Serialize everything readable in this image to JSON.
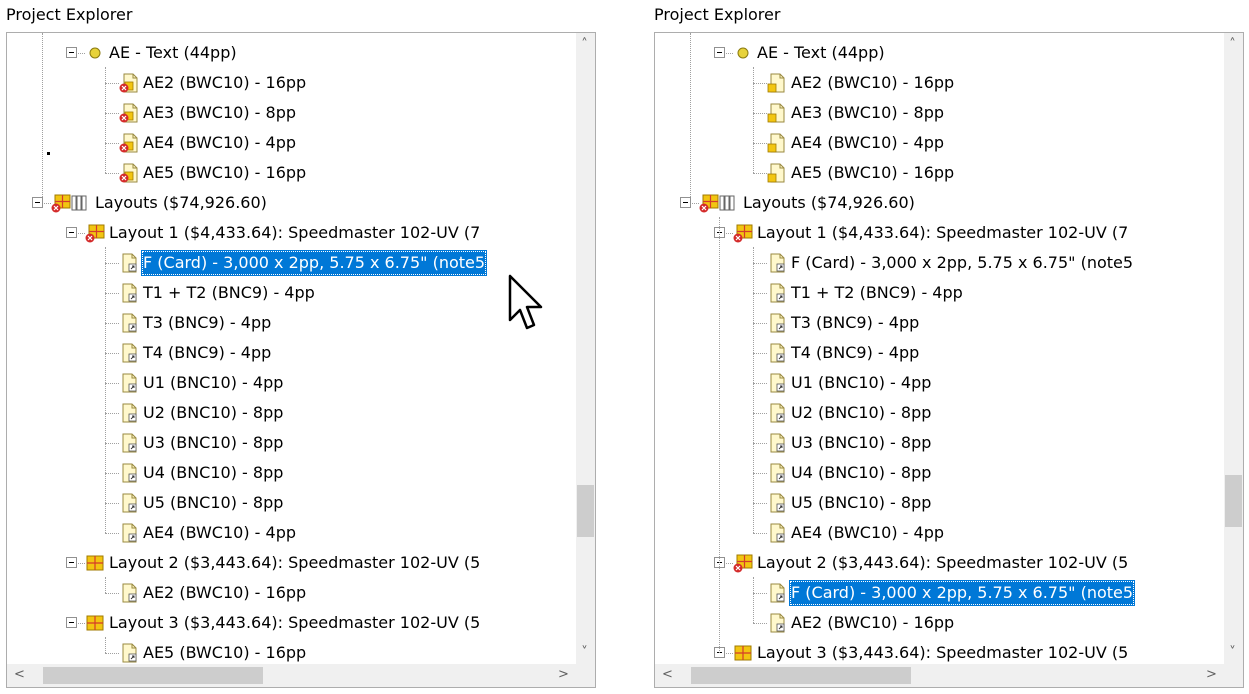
{
  "left": {
    "title": "Project Explorer",
    "items": [
      {
        "label": "AE - Text (44pp)",
        "icon": "status-dot-icon"
      },
      {
        "label": "AE2 (BWC10) - 16pp",
        "icon": "page-error-icon"
      },
      {
        "label": "AE3 (BWC10) - 8pp",
        "icon": "page-error-icon"
      },
      {
        "label": "AE4 (BWC10) - 4pp",
        "icon": "page-error-icon"
      },
      {
        "label": "AE5 (BWC10) - 16pp",
        "icon": "page-error-icon"
      },
      {
        "label": "Layouts ($74,926.60)",
        "icon": "layouts-error-icon"
      },
      {
        "label": "Layout 1 ($4,433.64): Speedmaster 102-UV (7",
        "icon": "layout-error-icon"
      },
      {
        "label": "F (Card) - 3,000 x 2pp, 5.75 x 6.75\" (note5",
        "icon": "page-link-icon",
        "selected": true
      },
      {
        "label": "T1 + T2 (BNC9) - 4pp",
        "icon": "page-link-icon"
      },
      {
        "label": "T3 (BNC9) - 4pp",
        "icon": "page-link-icon"
      },
      {
        "label": "T4 (BNC9) - 4pp",
        "icon": "page-link-icon"
      },
      {
        "label": "U1 (BNC10) - 4pp",
        "icon": "page-link-icon"
      },
      {
        "label": "U2 (BNC10) - 8pp",
        "icon": "page-link-icon"
      },
      {
        "label": "U3 (BNC10) - 8pp",
        "icon": "page-link-icon"
      },
      {
        "label": "U4 (BNC10) - 8pp",
        "icon": "page-link-icon"
      },
      {
        "label": "U5 (BNC10) - 8pp",
        "icon": "page-link-icon"
      },
      {
        "label": "AE4 (BWC10) - 4pp",
        "icon": "page-link-icon"
      },
      {
        "label": "Layout 2 ($3,443.64): Speedmaster 102-UV (5",
        "icon": "layout-icon"
      },
      {
        "label": "AE2 (BWC10) - 16pp",
        "icon": "page-link-icon"
      },
      {
        "label": "Layout 3 ($3,443.64): Speedmaster 102-UV (5",
        "icon": "layout-icon"
      },
      {
        "label": "AE5 (BWC10) - 16pp",
        "icon": "page-link-icon"
      }
    ]
  },
  "right": {
    "title": "Project Explorer",
    "items": [
      {
        "label": "AE - Text (44pp)",
        "icon": "status-dot-icon"
      },
      {
        "label": "AE2 (BWC10) - 16pp",
        "icon": "page-icon"
      },
      {
        "label": "AE3 (BWC10) - 8pp",
        "icon": "page-icon"
      },
      {
        "label": "AE4 (BWC10) - 4pp",
        "icon": "page-icon"
      },
      {
        "label": "AE5 (BWC10) - 16pp",
        "icon": "page-icon"
      },
      {
        "label": "Layouts ($74,926.60)",
        "icon": "layouts-error-icon"
      },
      {
        "label": "Layout 1 ($4,433.64): Speedmaster 102-UV (7",
        "icon": "layout-error-icon"
      },
      {
        "label": "F (Card) - 3,000 x 2pp, 5.75 x 6.75\" (note5",
        "icon": "page-link-icon"
      },
      {
        "label": "T1 + T2 (BNC9) - 4pp",
        "icon": "page-link-icon"
      },
      {
        "label": "T3 (BNC9) - 4pp",
        "icon": "page-link-icon"
      },
      {
        "label": "T4 (BNC9) - 4pp",
        "icon": "page-link-icon"
      },
      {
        "label": "U1 (BNC10) - 4pp",
        "icon": "page-link-icon"
      },
      {
        "label": "U2 (BNC10) - 8pp",
        "icon": "page-link-icon"
      },
      {
        "label": "U3 (BNC10) - 8pp",
        "icon": "page-link-icon"
      },
      {
        "label": "U4 (BNC10) - 8pp",
        "icon": "page-link-icon"
      },
      {
        "label": "U5 (BNC10) - 8pp",
        "icon": "page-link-icon"
      },
      {
        "label": "AE4 (BWC10) - 4pp",
        "icon": "page-link-icon"
      },
      {
        "label": "Layout 2 ($3,443.64): Speedmaster 102-UV (5",
        "icon": "layout-error-icon"
      },
      {
        "label": "F (Card) - 3,000 x 2pp, 5.75 x 6.75\" (note5",
        "icon": "page-link-icon",
        "selected": true
      },
      {
        "label": "AE2 (BWC10) - 16pp",
        "icon": "page-link-icon"
      },
      {
        "label": "Layout 3 ($3,443.64): Speedmaster 102-UV (5",
        "icon": "layout-icon"
      }
    ]
  },
  "scrollbar": {
    "up_icon": "scroll-up-icon",
    "down_icon": "scroll-down-icon",
    "left_icon": "scroll-left-icon",
    "right_icon": "scroll-right-icon"
  },
  "colors": {
    "selection": "#0078d7",
    "layout_icon": "#f2c511",
    "error_badge": "#d42b2b"
  }
}
